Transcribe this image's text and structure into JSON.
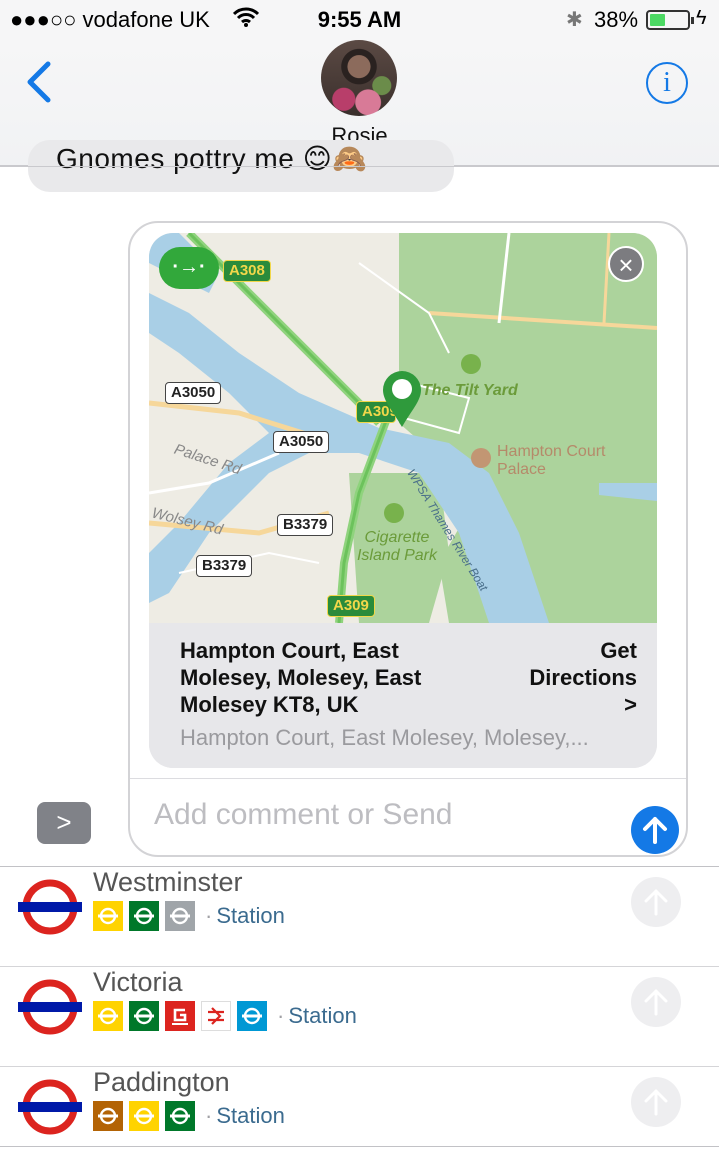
{
  "status_bar": {
    "carrier": "●●●○○ vodafone UK",
    "time": "9:55 AM",
    "battery_percent": "38%",
    "battery_level": 0.38,
    "wifi_icon": "wifi-icon",
    "bluetooth_icon": "bluetooth-icon"
  },
  "header": {
    "contact_name": "Rosie",
    "back_icon": "chevron-left-icon",
    "info_icon": "info-icon",
    "info_label": "i"
  },
  "previous_message": {
    "text": "Gnomes pottry me 😊🙈"
  },
  "map_card": {
    "close_label": "×",
    "directions_pill": "·→·",
    "road_labels": {
      "a308": "A308",
      "a3050_left": "A3050",
      "a309_top": "A309",
      "a3050_mid": "A3050",
      "b3379_mid": "B3379",
      "b3379_left": "B3379",
      "a309_bottom": "A309"
    },
    "street_labels": {
      "palace_rd": "Palace Rd",
      "wolsey_rd": "Wolsey Rd",
      "river_boat": "WPSA Thames River Boat"
    },
    "poi": {
      "tilt_yard": "The Tilt Yard",
      "hampton_court_palace": "Hampton Court Palace",
      "cigarette_island": "Cigarette Island Park"
    },
    "address_title": "Hampton Court, East Molesey, Molesey, East Molesey KT8, UK",
    "directions_label": "Get Directions",
    "directions_chevron": ">",
    "address_subtitle": "Hampton Court, East Molesey, Molesey,..."
  },
  "composer": {
    "placeholder": "Add comment or Send",
    "send_icon": "arrow-up-icon",
    "expand_label": ">"
  },
  "colors": {
    "accent_blue": "#1479e6",
    "tube_red": "#dc241f",
    "tube_blue": "#0019a8",
    "station_text": "#3b6b8f"
  },
  "stations": [
    {
      "name": "Westminster",
      "suffix": "Station",
      "lines": [
        {
          "icon": "tube-icon",
          "color": "#ffd300"
        },
        {
          "icon": "tube-icon",
          "color": "#00782a"
        },
        {
          "icon": "tube-icon",
          "color": "#a0a5a9"
        }
      ]
    },
    {
      "name": "Victoria",
      "suffix": "Station",
      "lines": [
        {
          "icon": "tube-icon",
          "color": "#ffd300"
        },
        {
          "icon": "tube-icon",
          "color": "#00782a"
        },
        {
          "icon": "gatwick-express-icon",
          "color": "#dc241f"
        },
        {
          "icon": "national-rail-icon",
          "color": "#ffffff"
        },
        {
          "icon": "tube-icon",
          "color": "#0098d4"
        }
      ]
    },
    {
      "name": "Paddington",
      "suffix": "Station",
      "lines": [
        {
          "icon": "tube-icon",
          "color": "#b36305"
        },
        {
          "icon": "tube-icon",
          "color": "#ffd300"
        },
        {
          "icon": "tube-icon",
          "color": "#00782a"
        }
      ]
    }
  ]
}
